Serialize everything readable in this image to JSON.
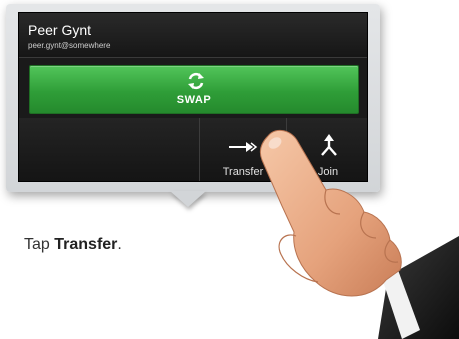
{
  "call": {
    "name": "Peer Gynt",
    "email": "peer.gynt@somewhere"
  },
  "swap": {
    "label": "SWAP",
    "icon": "swap-arrows-icon"
  },
  "actions": [
    {
      "label": "Transfer",
      "icon": "transfer-arrow-icon"
    },
    {
      "label": "Join",
      "icon": "join-arrows-icon"
    }
  ],
  "instruction": {
    "prefix": "Tap ",
    "emphasis": "Transfer",
    "suffix": "."
  },
  "colors": {
    "swap_green": "#2f9e38",
    "screen_bg": "#1a1a1a",
    "frame_grey": "#d8dadd"
  }
}
